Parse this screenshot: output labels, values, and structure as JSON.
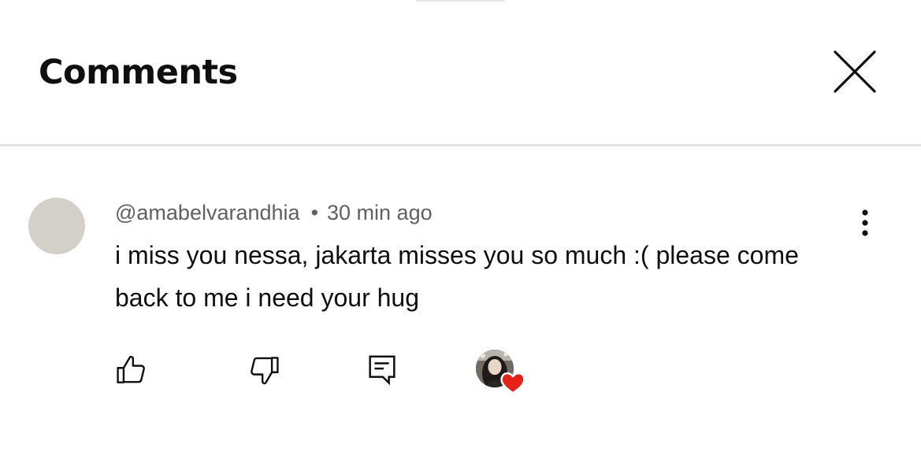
{
  "sheet": {
    "title": "Comments"
  },
  "icons": {
    "close": "close-icon",
    "more": "more-vert-icon",
    "like": "thumbs-up-icon",
    "dislike": "thumbs-down-icon",
    "reply": "reply-comment-icon",
    "heart": "heart-icon"
  },
  "comment": {
    "author": "@amabelvarandhia",
    "separator": "•",
    "timestamp": "30 min ago",
    "text": "i miss you nessa, jakarta misses you so much :( please come back to me i need your hug",
    "hearted_by_creator": true
  },
  "colors": {
    "heart": "#e62117",
    "avatar_placeholder": "#d2d0c8",
    "meta_text": "#606060",
    "divider": "#e3e3e3"
  }
}
